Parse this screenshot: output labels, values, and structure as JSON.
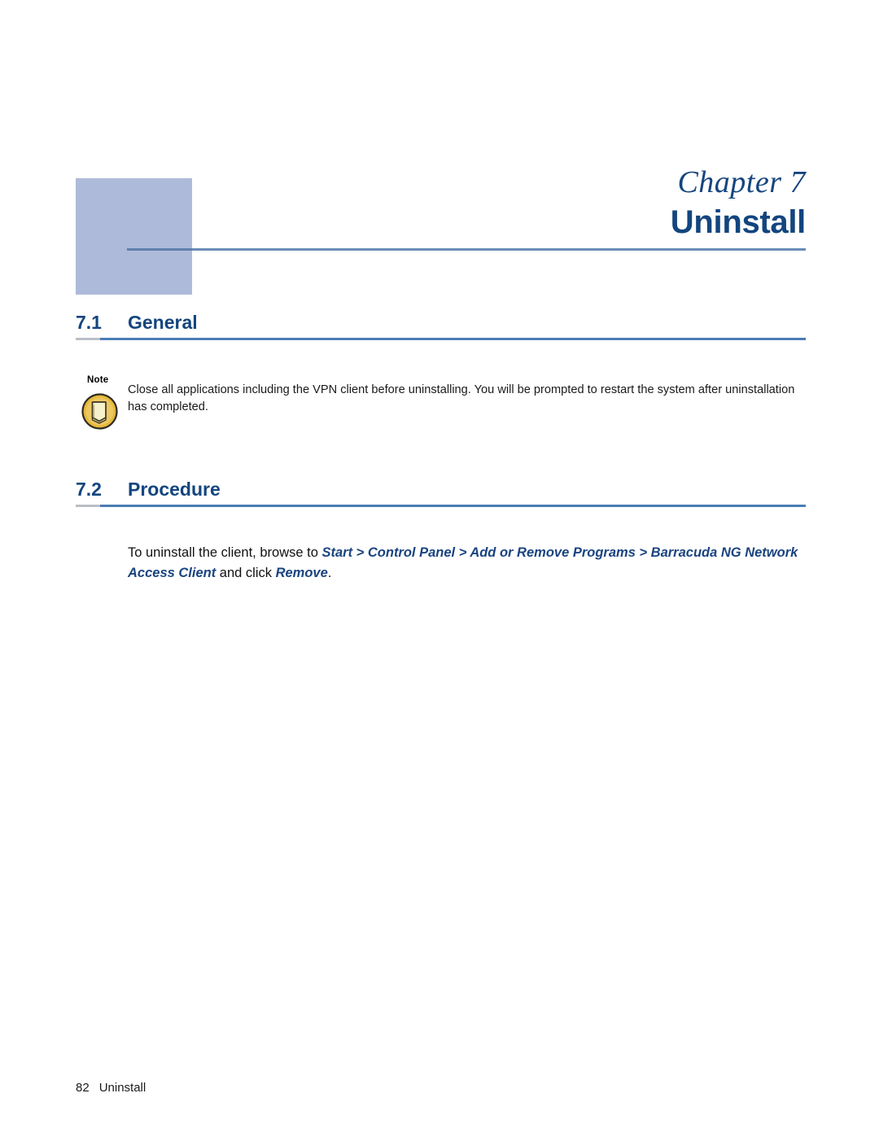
{
  "document": {
    "chapter_label": "Chapter 7",
    "chapter_title": "Uninstall",
    "accent_block_color": "#aebada",
    "heading_color": "#13457f",
    "rule_color": "#4a7cb5"
  },
  "sections": [
    {
      "number": "7.1",
      "name": "General"
    },
    {
      "number": "7.2",
      "name": "Procedure"
    }
  ],
  "note": {
    "label": "Note",
    "icon": "note-page-icon",
    "icon_circle_color": "#e6b83c",
    "icon_page_color": "#f4eeca",
    "text": "Close all applications including the VPN client before uninstalling. You will be prompted to restart the system after uninstallation has completed."
  },
  "procedure": {
    "lead_text": "To uninstall the client, browse to ",
    "path": "Start > Control Panel > Add or Remove Programs > Barracuda NG Network Access Client",
    "middle_text": " and click ",
    "action": "Remove",
    "trailing_text": ".",
    "path_color": "#1a4480"
  },
  "footer": {
    "page_number": "82",
    "chapter_name": "Uninstall"
  }
}
